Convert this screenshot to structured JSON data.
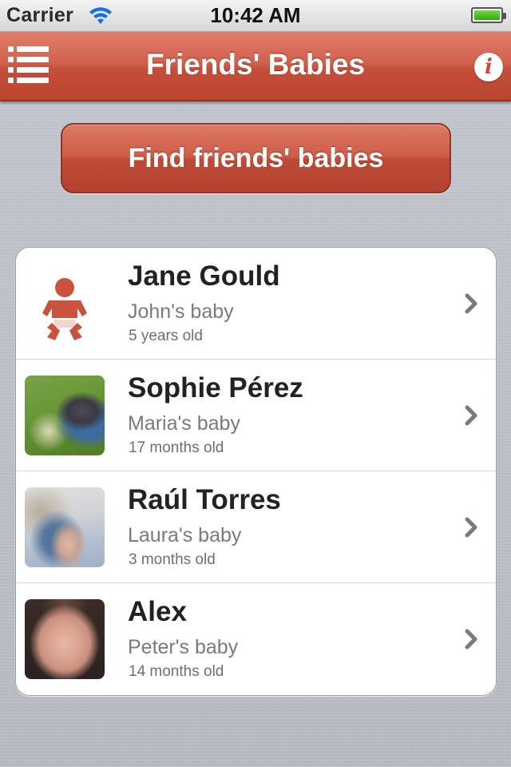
{
  "status_bar": {
    "carrier": "Carrier",
    "time": "10:42 AM",
    "battery_level": 1.0
  },
  "nav": {
    "title": "Friends' Babies",
    "menu_icon": "list-menu-icon",
    "info_icon": "info-icon",
    "info_glyph": "i"
  },
  "find_button": {
    "label": "Find friends' babies"
  },
  "babies": [
    {
      "name": "Jane Gould",
      "parent": "John's baby",
      "age": "5 years old",
      "thumb": "baby-silhouette-icon"
    },
    {
      "name": "Sophie Pérez",
      "parent": "Maria's baby",
      "age": "17 months old",
      "thumb": "baby-photo"
    },
    {
      "name": "Raúl Torres",
      "parent": "Laura's baby",
      "age": "3 months old",
      "thumb": "baby-photo"
    },
    {
      "name": "Alex",
      "parent": "Peter's baby",
      "age": "14 months old",
      "thumb": "baby-photo"
    }
  ],
  "colors": {
    "accent": "#c84f3a",
    "nav_top": "#e07f6c",
    "nav_bottom": "#bc4531",
    "background": "#c4c9d1"
  }
}
